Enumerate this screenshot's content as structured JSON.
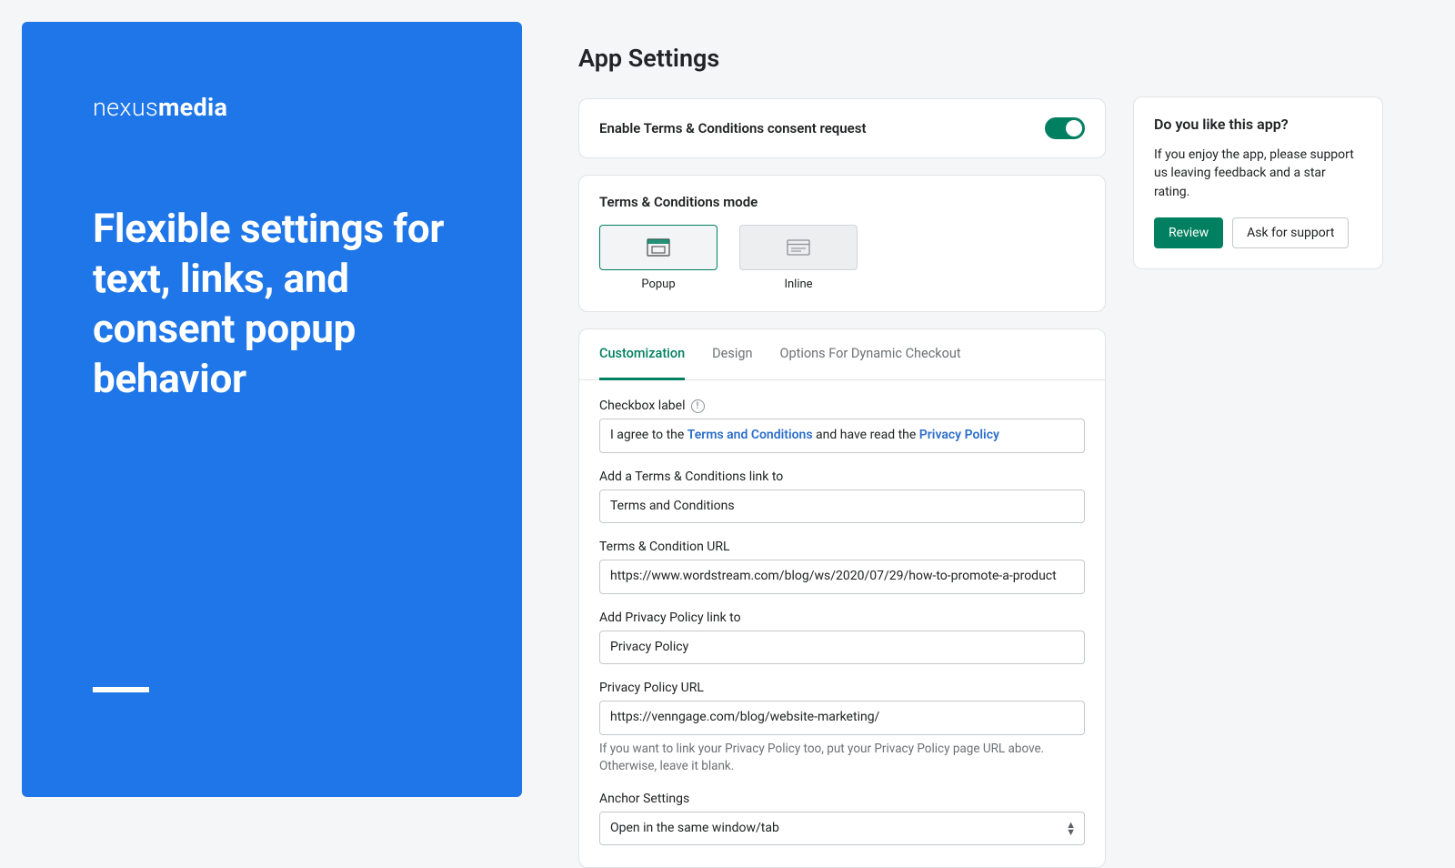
{
  "brand": {
    "light": "nexus",
    "bold": "media"
  },
  "headline": "Flexible settings for text, links, and consent popup behavior",
  "page_title": "App Settings",
  "enable": {
    "label": "Enable Terms & Conditions consent request",
    "on": true
  },
  "mode": {
    "title": "Terms & Conditions mode",
    "options": [
      {
        "label": "Popup",
        "selected": true
      },
      {
        "label": "Inline",
        "selected": false
      }
    ]
  },
  "tabs": [
    {
      "label": "Customization",
      "active": true
    },
    {
      "label": "Design",
      "active": false
    },
    {
      "label": "Options For Dynamic Checkout",
      "active": false
    }
  ],
  "fields": {
    "checkbox_label": {
      "label": "Checkbox label",
      "pre": "I agree to the ",
      "link1": "Terms and Conditions",
      "mid": " and have read the ",
      "link2": "Privacy Policy"
    },
    "tc_link_to": {
      "label": "Add a Terms & Conditions link to",
      "value": "Terms and Conditions"
    },
    "tc_url": {
      "label": "Terms & Condition URL",
      "value": "https://www.wordstream.com/blog/ws/2020/07/29/how-to-promote-a-product"
    },
    "pp_link_to": {
      "label": "Add Privacy Policy link to",
      "value": "Privacy Policy"
    },
    "pp_url": {
      "label": "Privacy Policy URL",
      "value": "https://venngage.com/blog/website-marketing/",
      "help": "If you want to link your Privacy Policy too, put your Privacy Policy page URL above. Otherwise, leave it blank."
    },
    "anchor": {
      "label": "Anchor Settings",
      "value": "Open in the same window/tab"
    }
  },
  "side": {
    "title": "Do you like this app?",
    "text": "If you enjoy the app, please support us leaving feedback and a star rating.",
    "review": "Review",
    "support": "Ask for support"
  }
}
